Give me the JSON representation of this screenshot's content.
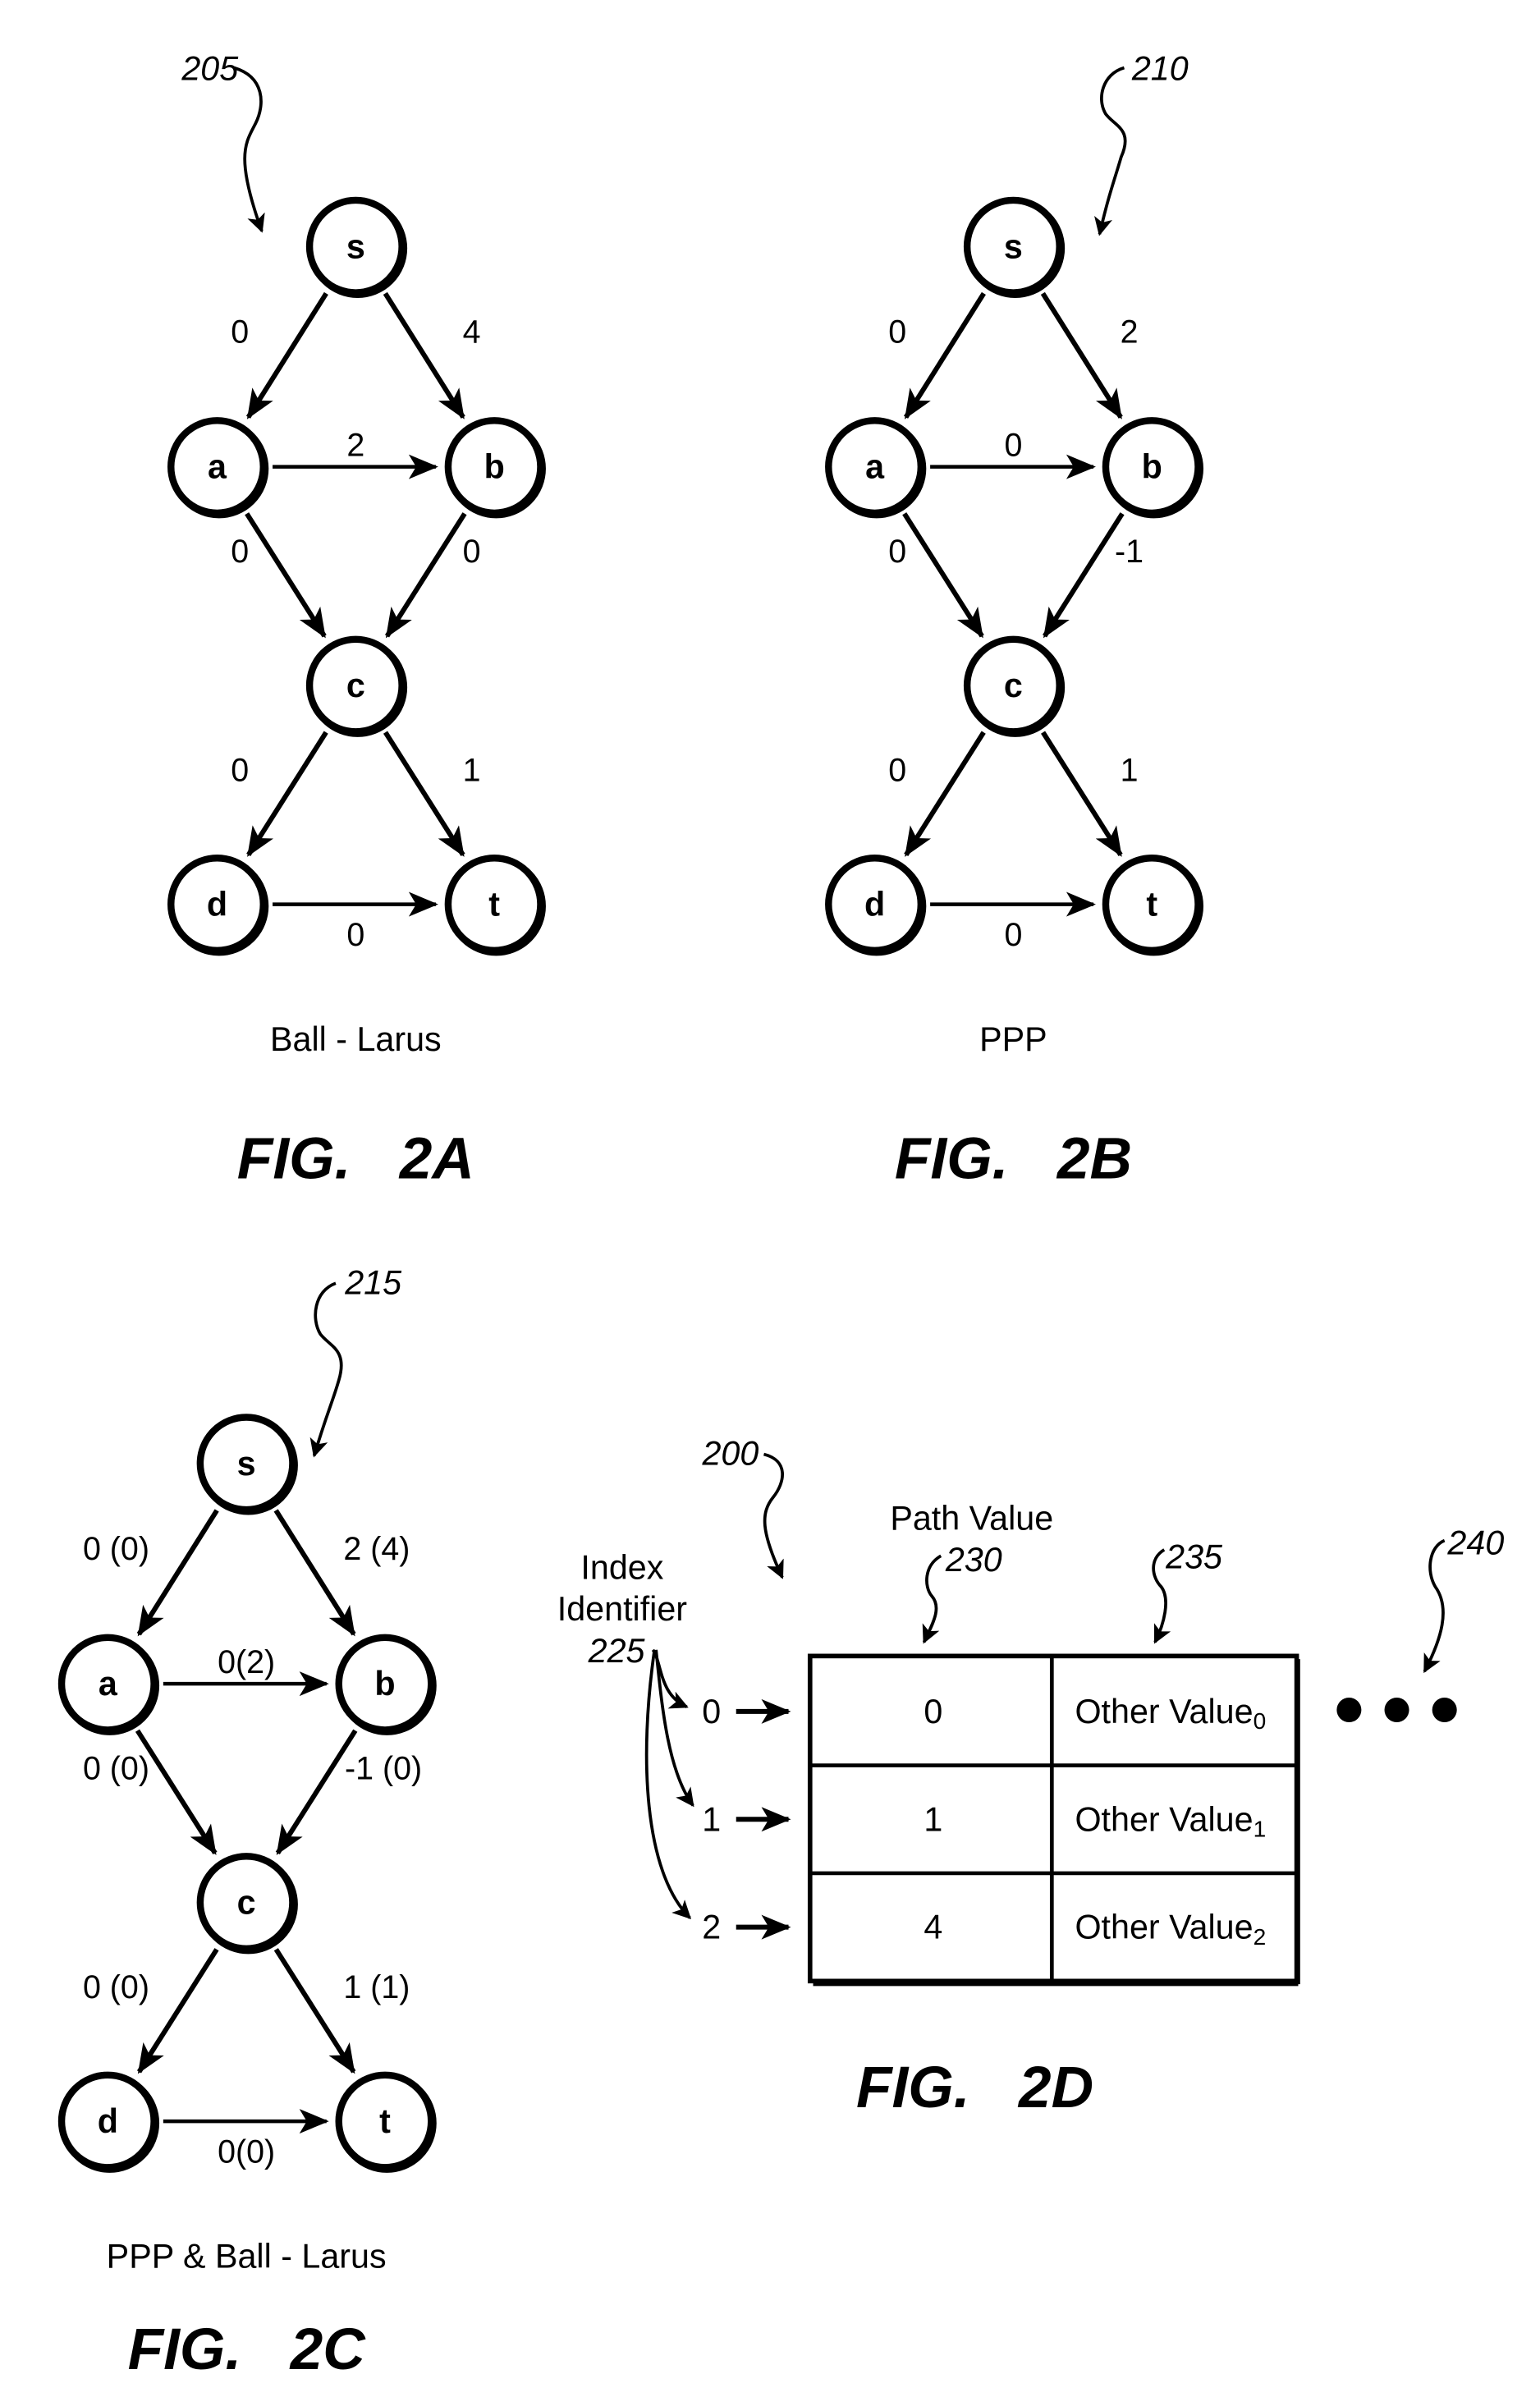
{
  "figures": [
    {
      "id": "2A",
      "title": "FIG.   2A",
      "caption": "Ball - Larus",
      "ref": "205",
      "nodes": [
        "s",
        "a",
        "b",
        "c",
        "d",
        "t"
      ],
      "edges": [
        {
          "from": "s",
          "to": "a",
          "label": "0"
        },
        {
          "from": "s",
          "to": "b",
          "label": "4"
        },
        {
          "from": "a",
          "to": "b",
          "label": "2"
        },
        {
          "from": "a",
          "to": "c",
          "label": "0"
        },
        {
          "from": "b",
          "to": "c",
          "label": "0"
        },
        {
          "from": "c",
          "to": "d",
          "label": "0"
        },
        {
          "from": "c",
          "to": "t",
          "label": "1"
        },
        {
          "from": "d",
          "to": "t",
          "label": "0"
        }
      ]
    },
    {
      "id": "2B",
      "title": "FIG.   2B",
      "caption": "PPP",
      "ref": "210",
      "nodes": [
        "s",
        "a",
        "b",
        "c",
        "d",
        "t"
      ],
      "edges": [
        {
          "from": "s",
          "to": "a",
          "label": "0"
        },
        {
          "from": "s",
          "to": "b",
          "label": "2"
        },
        {
          "from": "a",
          "to": "b",
          "label": "0"
        },
        {
          "from": "a",
          "to": "c",
          "label": "0"
        },
        {
          "from": "b",
          "to": "c",
          "label": "-1"
        },
        {
          "from": "c",
          "to": "d",
          "label": "0"
        },
        {
          "from": "c",
          "to": "t",
          "label": "1"
        },
        {
          "from": "d",
          "to": "t",
          "label": "0"
        }
      ]
    },
    {
      "id": "2C",
      "title": "FIG.   2C",
      "caption": "PPP & Ball - Larus",
      "ref": "215",
      "nodes": [
        "s",
        "a",
        "b",
        "c",
        "d",
        "t"
      ],
      "edges": [
        {
          "from": "s",
          "to": "a",
          "label": "0 (0)"
        },
        {
          "from": "s",
          "to": "b",
          "label": "2 (4)"
        },
        {
          "from": "a",
          "to": "b",
          "label": "0(2)"
        },
        {
          "from": "a",
          "to": "c",
          "label": "0 (0)"
        },
        {
          "from": "b",
          "to": "c",
          "label": "-1 (0)"
        },
        {
          "from": "c",
          "to": "d",
          "label": "0 (0)"
        },
        {
          "from": "c",
          "to": "t",
          "label": "1 (1)"
        },
        {
          "from": "d",
          "to": "t",
          "label": "0(0)"
        }
      ]
    }
  ],
  "table_figure": {
    "id": "2D",
    "title": "FIG.   2D",
    "ref": "200",
    "index_label_line1": "Index",
    "index_label_line2": "Identifier",
    "index_ref": "225",
    "path_value_header": "Path Value",
    "path_value_ref": "230",
    "other_value_ref": "235",
    "ellipsis_ref": "240",
    "rows": [
      {
        "index": "0",
        "path_value": "0",
        "other_value": "Other Value",
        "subscript": "0"
      },
      {
        "index": "1",
        "path_value": "1",
        "other_value": "Other Value",
        "subscript": "1"
      },
      {
        "index": "2",
        "path_value": "4",
        "other_value": "Other Value",
        "subscript": "2"
      }
    ],
    "ellipsis": "• • •"
  }
}
